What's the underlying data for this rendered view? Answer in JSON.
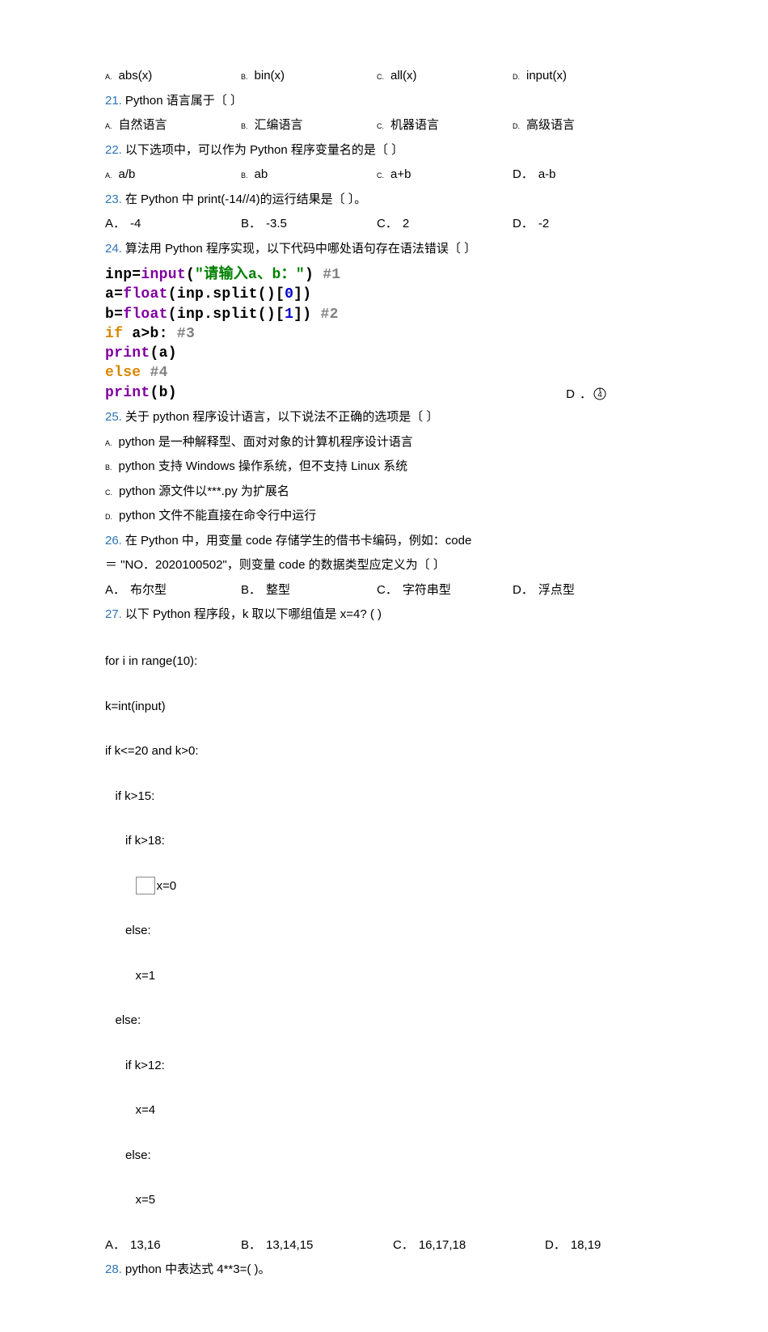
{
  "q20": {
    "opts": [
      {
        "l": "A.",
        "t": "abs(x)"
      },
      {
        "l": "B.",
        "t": "bin(x)"
      },
      {
        "l": "C.",
        "t": "all(x)"
      },
      {
        "l": "D.",
        "t": "input(x)"
      }
    ]
  },
  "q21": {
    "num": "21.",
    "stem": "Python 语言属于〔  〕",
    "opts": [
      {
        "l": "A.",
        "t": "自然语言"
      },
      {
        "l": "B.",
        "t": "汇编语言"
      },
      {
        "l": "C.",
        "t": "机器语言"
      },
      {
        "l": "D.",
        "t": "高级语言"
      }
    ]
  },
  "q22": {
    "num": "22.",
    "stem": "以下选项中，可以作为 Python 程序变量名的是〔  〕",
    "opts": [
      {
        "l": "A.",
        "t": "a/b"
      },
      {
        "l": "B.",
        "t": "ab"
      },
      {
        "l": "C.",
        "t": "a+b"
      },
      {
        "l": "D．",
        "t": "a-b"
      }
    ]
  },
  "q23": {
    "num": "23.",
    "stem": "在 Python 中 print(-14//4)的运行结果是〔  〕。",
    "opts": [
      {
        "l": "A．",
        "t": "-4"
      },
      {
        "l": "B．",
        "t": "-3.5"
      },
      {
        "l": "C．",
        "t": "2"
      },
      {
        "l": "D．",
        "t": "-2"
      }
    ]
  },
  "q24": {
    "num": "24.",
    "stem": "算法用 Python 程序实现，以下代码中哪处语句存在语法错误〔  〕",
    "code": {
      "l1a": "inp=",
      "l1b": "input",
      "l1c": "(",
      "l1d": "\"请输入a、b：\"",
      "l1e": ")   ",
      "l1f": "#1",
      "l2a": "a=",
      "l2b": "float",
      "l2c": "(inp.split()[",
      "l2d": "0",
      "l2e": "])",
      "l3a": "b=",
      "l3b": "float",
      "l3c": "(inp.split()[",
      "l3d": "1",
      "l3e": "])   ",
      "l3f": "#2",
      "l4a": "if",
      "l4b": " a>b:   ",
      "l4c": "#3",
      "l5a": "    ",
      "l5b": "print",
      "l5c": "(a)",
      "l6a": "else",
      "l6b": "      ",
      "l6c": "#4",
      "l7a": "    ",
      "l7b": "print",
      "l7c": "(b)"
    },
    "optD": {
      "l": "D",
      "t": "④"
    },
    "optD_prefix": "．"
  },
  "q25": {
    "num": "25.",
    "stem": "关于 python 程序设计语言，以下说法不正确的选项是〔  〕",
    "opts": [
      {
        "l": "A.",
        "t": "python 是一种解释型、面对对象的计算机程序设计语言"
      },
      {
        "l": "B.",
        "t": "python 支持 Windows 操作系统，但不支持 Linux 系统"
      },
      {
        "l": "C.",
        "t": "python 源文件以***.py 为扩展名"
      },
      {
        "l": "D.",
        "t": "python 文件不能直接在命令行中运行"
      }
    ]
  },
  "q26": {
    "num": "26.",
    "stem1": "在 Python 中，用变量 code 存储学生的借书卡编码，例如：code",
    "stem2": "＝  \"NO．2020100502\"，则变量 code 的数据类型应定义为〔  〕",
    "opts": [
      {
        "l": "A．",
        "t": "布尔型"
      },
      {
        "l": "B．",
        "t": "整型"
      },
      {
        "l": "C．",
        "t": "字符串型"
      },
      {
        "l": "D．",
        "t": "浮点型"
      }
    ]
  },
  "q27": {
    "num": "27.",
    "stem": "以下 Python 程序段，k 取以下哪组值是 x=4? (          )",
    "code": {
      "l1": "for i in range(10):",
      "l2": "k=int(input)",
      "l3": "if k<=20 and k>0:",
      "l4": "   if k>15:",
      "l5": "      if k>18:",
      "l6b": "x=0",
      "l7": "      else:",
      "l8": "         x=1",
      "l9": "   else:",
      "l10": "      if k>12:",
      "l11": "         x=4",
      "l12": "      else:",
      "l13": "         x=5"
    },
    "opts": [
      {
        "l": "A．",
        "t": "13,16"
      },
      {
        "l": "B．",
        "t": "13,14,15"
      },
      {
        "l": "C．",
        "t": "16,17,18"
      },
      {
        "l": "D．",
        "t": "18,19"
      }
    ]
  },
  "q28": {
    "num": "28.",
    "stem": "python 中表达式 4**3=(       )。"
  }
}
